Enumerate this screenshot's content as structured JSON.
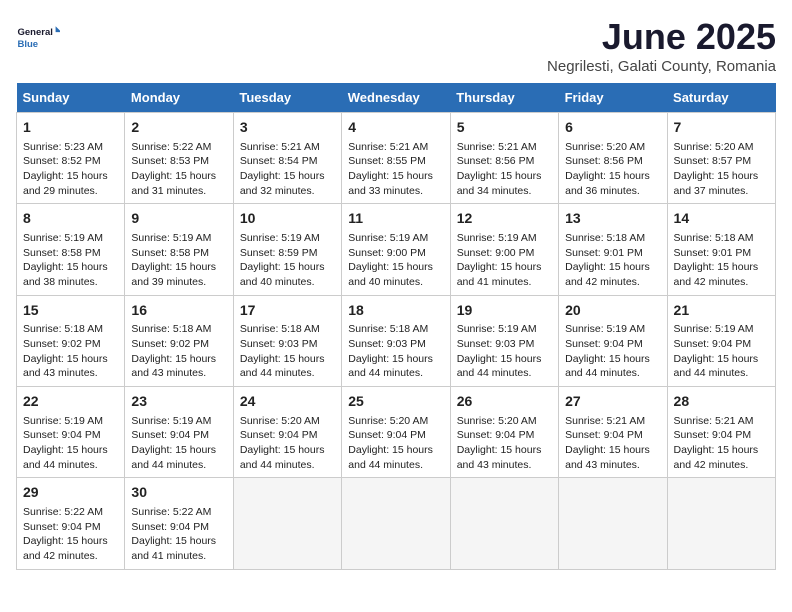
{
  "logo": {
    "line1": "General",
    "line2": "Blue"
  },
  "title": "June 2025",
  "location": "Negrilesti, Galati County, Romania",
  "weekdays": [
    "Sunday",
    "Monday",
    "Tuesday",
    "Wednesday",
    "Thursday",
    "Friday",
    "Saturday"
  ],
  "weeks": [
    [
      {
        "day": "1",
        "info": "Sunrise: 5:23 AM\nSunset: 8:52 PM\nDaylight: 15 hours\nand 29 minutes."
      },
      {
        "day": "2",
        "info": "Sunrise: 5:22 AM\nSunset: 8:53 PM\nDaylight: 15 hours\nand 31 minutes."
      },
      {
        "day": "3",
        "info": "Sunrise: 5:21 AM\nSunset: 8:54 PM\nDaylight: 15 hours\nand 32 minutes."
      },
      {
        "day": "4",
        "info": "Sunrise: 5:21 AM\nSunset: 8:55 PM\nDaylight: 15 hours\nand 33 minutes."
      },
      {
        "day": "5",
        "info": "Sunrise: 5:21 AM\nSunset: 8:56 PM\nDaylight: 15 hours\nand 34 minutes."
      },
      {
        "day": "6",
        "info": "Sunrise: 5:20 AM\nSunset: 8:56 PM\nDaylight: 15 hours\nand 36 minutes."
      },
      {
        "day": "7",
        "info": "Sunrise: 5:20 AM\nSunset: 8:57 PM\nDaylight: 15 hours\nand 37 minutes."
      }
    ],
    [
      {
        "day": "8",
        "info": "Sunrise: 5:19 AM\nSunset: 8:58 PM\nDaylight: 15 hours\nand 38 minutes."
      },
      {
        "day": "9",
        "info": "Sunrise: 5:19 AM\nSunset: 8:58 PM\nDaylight: 15 hours\nand 39 minutes."
      },
      {
        "day": "10",
        "info": "Sunrise: 5:19 AM\nSunset: 8:59 PM\nDaylight: 15 hours\nand 40 minutes."
      },
      {
        "day": "11",
        "info": "Sunrise: 5:19 AM\nSunset: 9:00 PM\nDaylight: 15 hours\nand 40 minutes."
      },
      {
        "day": "12",
        "info": "Sunrise: 5:19 AM\nSunset: 9:00 PM\nDaylight: 15 hours\nand 41 minutes."
      },
      {
        "day": "13",
        "info": "Sunrise: 5:18 AM\nSunset: 9:01 PM\nDaylight: 15 hours\nand 42 minutes."
      },
      {
        "day": "14",
        "info": "Sunrise: 5:18 AM\nSunset: 9:01 PM\nDaylight: 15 hours\nand 42 minutes."
      }
    ],
    [
      {
        "day": "15",
        "info": "Sunrise: 5:18 AM\nSunset: 9:02 PM\nDaylight: 15 hours\nand 43 minutes."
      },
      {
        "day": "16",
        "info": "Sunrise: 5:18 AM\nSunset: 9:02 PM\nDaylight: 15 hours\nand 43 minutes."
      },
      {
        "day": "17",
        "info": "Sunrise: 5:18 AM\nSunset: 9:03 PM\nDaylight: 15 hours\nand 44 minutes."
      },
      {
        "day": "18",
        "info": "Sunrise: 5:18 AM\nSunset: 9:03 PM\nDaylight: 15 hours\nand 44 minutes."
      },
      {
        "day": "19",
        "info": "Sunrise: 5:19 AM\nSunset: 9:03 PM\nDaylight: 15 hours\nand 44 minutes."
      },
      {
        "day": "20",
        "info": "Sunrise: 5:19 AM\nSunset: 9:04 PM\nDaylight: 15 hours\nand 44 minutes."
      },
      {
        "day": "21",
        "info": "Sunrise: 5:19 AM\nSunset: 9:04 PM\nDaylight: 15 hours\nand 44 minutes."
      }
    ],
    [
      {
        "day": "22",
        "info": "Sunrise: 5:19 AM\nSunset: 9:04 PM\nDaylight: 15 hours\nand 44 minutes."
      },
      {
        "day": "23",
        "info": "Sunrise: 5:19 AM\nSunset: 9:04 PM\nDaylight: 15 hours\nand 44 minutes."
      },
      {
        "day": "24",
        "info": "Sunrise: 5:20 AM\nSunset: 9:04 PM\nDaylight: 15 hours\nand 44 minutes."
      },
      {
        "day": "25",
        "info": "Sunrise: 5:20 AM\nSunset: 9:04 PM\nDaylight: 15 hours\nand 44 minutes."
      },
      {
        "day": "26",
        "info": "Sunrise: 5:20 AM\nSunset: 9:04 PM\nDaylight: 15 hours\nand 43 minutes."
      },
      {
        "day": "27",
        "info": "Sunrise: 5:21 AM\nSunset: 9:04 PM\nDaylight: 15 hours\nand 43 minutes."
      },
      {
        "day": "28",
        "info": "Sunrise: 5:21 AM\nSunset: 9:04 PM\nDaylight: 15 hours\nand 42 minutes."
      }
    ],
    [
      {
        "day": "29",
        "info": "Sunrise: 5:22 AM\nSunset: 9:04 PM\nDaylight: 15 hours\nand 42 minutes."
      },
      {
        "day": "30",
        "info": "Sunrise: 5:22 AM\nSunset: 9:04 PM\nDaylight: 15 hours\nand 41 minutes."
      },
      {
        "day": "",
        "info": ""
      },
      {
        "day": "",
        "info": ""
      },
      {
        "day": "",
        "info": ""
      },
      {
        "day": "",
        "info": ""
      },
      {
        "day": "",
        "info": ""
      }
    ]
  ]
}
